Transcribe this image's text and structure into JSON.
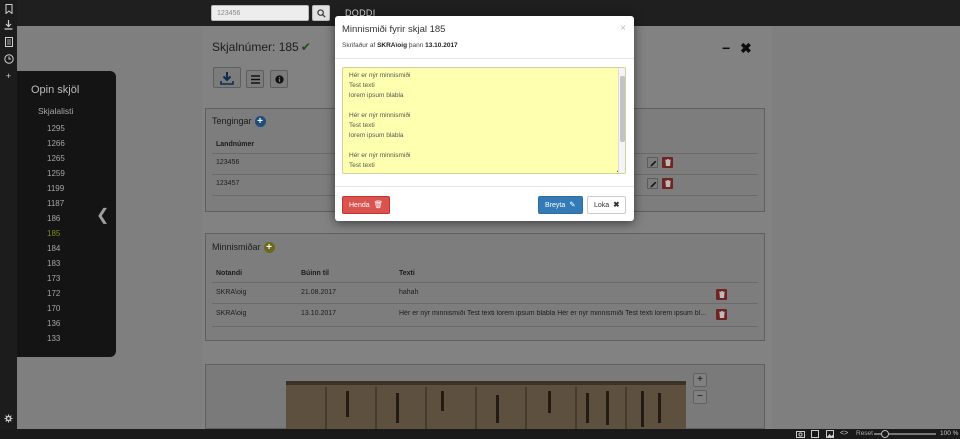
{
  "topbar": {
    "search_value": "123456",
    "brand": "DODDI"
  },
  "document": {
    "title": "Skjalnúmer: 185",
    "tengingar": {
      "title": "Tengingar",
      "col_landnumer": "Landnúmer",
      "rows": [
        "123456",
        "123457"
      ]
    },
    "minnismidar": {
      "title": "Minnismiðar",
      "columns": [
        "Notandi",
        "Búinn til",
        "Texti"
      ],
      "rows": [
        {
          "user": "SKRA\\oig",
          "created": "21.08.2017",
          "text": "hahah"
        },
        {
          "user": "SKRA\\oig",
          "created": "13.10.2017",
          "text": "Hér er nýr minnismiði Test texti lorem ipsum blabla Hér er nýr minnismiði Test texti lorem ipsum bl..."
        }
      ]
    }
  },
  "sidebar": {
    "title": "Opin skjöl",
    "subtitle": "Skjalalisti",
    "items": [
      "1295",
      "1266",
      "1265",
      "1259",
      "1199",
      "1187",
      "186",
      "185",
      "184",
      "183",
      "173",
      "172",
      "170",
      "136",
      "133"
    ],
    "active_item": "185"
  },
  "modal": {
    "title": "Minnismiði fyrir skjal 185",
    "meta_prefix": "Skrifaður af",
    "meta_author": "SKRA\\oig",
    "meta_mid": "þann",
    "meta_date": "13.10.2017",
    "note_text": "Hér er nýr minnismiði\nTest texti\nlorem ipsum blabla\n\nHér er nýr minnismiði\nTest texti\nlorem ipsum blabla\n\nHér er nýr minnismiði\nTest texti",
    "delete_label": "Henda",
    "edit_label": "Breyta",
    "close_label": "Loka"
  },
  "statusbar": {
    "reset_label": "Reset",
    "zoom": "100 %"
  },
  "colors": {
    "accent_blue": "#337ab7",
    "danger_red": "#d9534f",
    "note_yellow": "#ffffb0"
  }
}
